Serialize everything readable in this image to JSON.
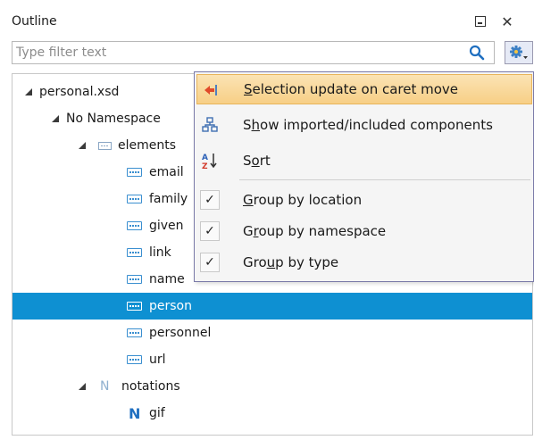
{
  "window": {
    "title": "Outline"
  },
  "filter": {
    "placeholder": "Type filter text",
    "value": ""
  },
  "tree": {
    "root": {
      "label": "personal.xsd"
    },
    "namespace": {
      "label": "No Namespace"
    },
    "elements_group": {
      "label": "elements"
    },
    "elements": [
      {
        "label": "email"
      },
      {
        "label": "family"
      },
      {
        "label": "given"
      },
      {
        "label": "link"
      },
      {
        "label": "name"
      },
      {
        "label": "person",
        "selected": true
      },
      {
        "label": "personnel"
      },
      {
        "label": "url"
      }
    ],
    "notations_group": {
      "label": "notations",
      "icon_letter": "N"
    },
    "notations": [
      {
        "label": "gif",
        "icon_letter": "N"
      }
    ]
  },
  "menu": {
    "items": [
      {
        "pre": "",
        "key": "S",
        "post": "election update on caret move",
        "highlighted": true
      },
      {
        "pre": "S",
        "key": "h",
        "post": "ow imported/included components"
      },
      {
        "pre": "S",
        "key": "o",
        "post": "rt"
      },
      {
        "pre": "",
        "key": "G",
        "post": "roup by location",
        "checked": true
      },
      {
        "pre": "G",
        "key": "r",
        "post": "oup by namespace",
        "checked": true
      },
      {
        "pre": "Gro",
        "key": "u",
        "post": "p by type",
        "checked": true
      }
    ],
    "check_glyph": "✓"
  },
  "colors": {
    "selection": "#0e90d2",
    "menu_highlight": "#f7cf86",
    "element_icon": "#3a8fd0",
    "notation_icon": "#1f6fc0"
  }
}
